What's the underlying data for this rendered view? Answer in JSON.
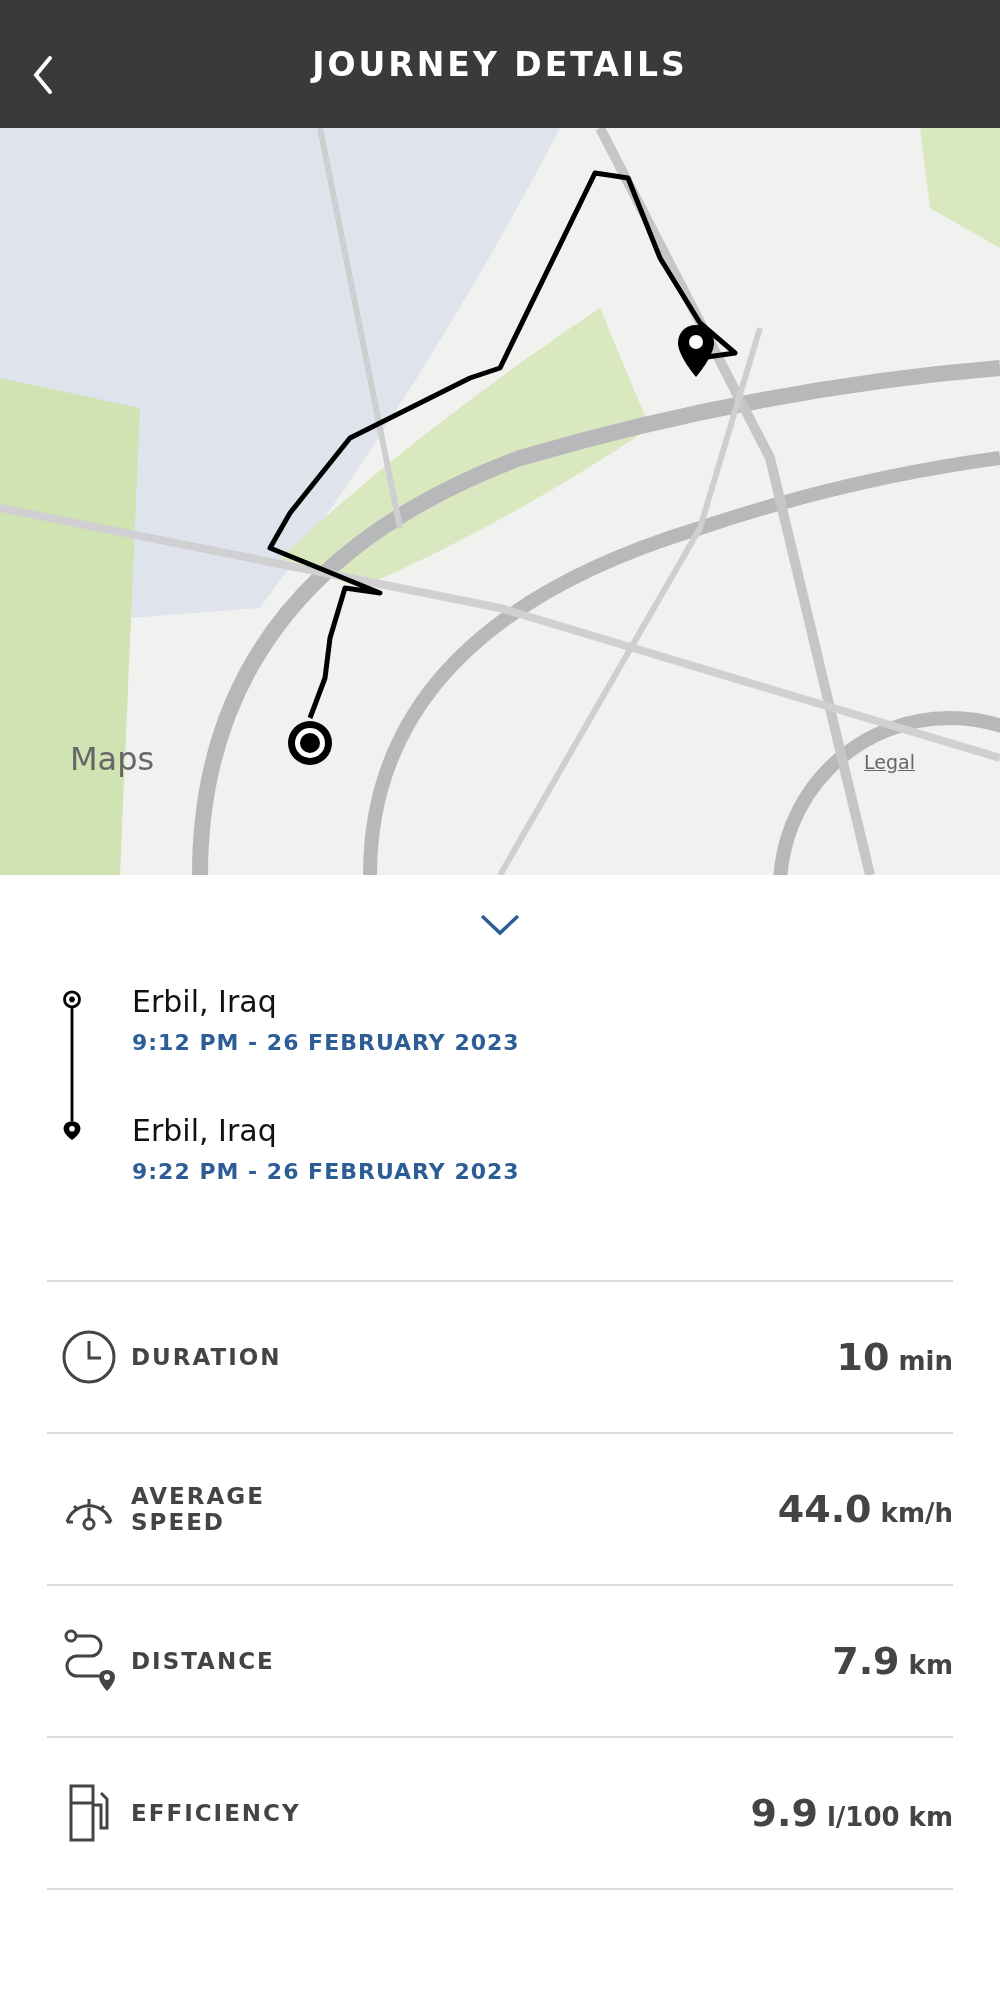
{
  "header": {
    "title": "JOURNEY DETAILS"
  },
  "map": {
    "kind": "picture",
    "attribution": "Maps",
    "legal": "Legal"
  },
  "journey": {
    "start": {
      "place": "Erbil, Iraq",
      "time": "9:12 PM - 26 FEBRUARY 2023"
    },
    "end": {
      "place": "Erbil, Iraq",
      "time": "9:22 PM - 26 FEBRUARY 2023"
    }
  },
  "stats": [
    {
      "kind": "duration",
      "label": "DURATION",
      "value": "10",
      "unit": "min"
    },
    {
      "kind": "speed",
      "label": "AVERAGE SPEED",
      "value": "44.0",
      "unit": "km/h"
    },
    {
      "kind": "distance",
      "label": "DISTANCE",
      "value": "7.9",
      "unit": "km"
    },
    {
      "kind": "efficiency",
      "label": "EFFICIENCY",
      "value": "9.9",
      "unit": "l/100 km"
    }
  ]
}
